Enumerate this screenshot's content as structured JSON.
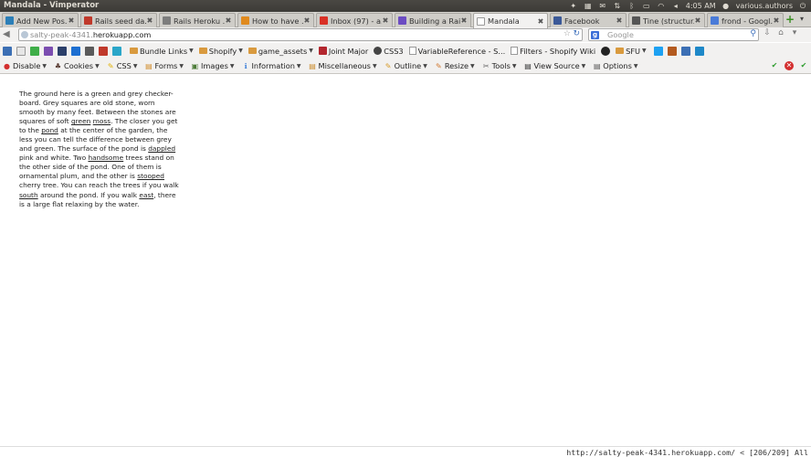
{
  "window": {
    "title": "Mandala - Vimperator"
  },
  "tray": {
    "time": "4:05 AM",
    "user": "various.authors"
  },
  "tabs": [
    {
      "label": "Add New Pos...",
      "color": "#2c7fb8"
    },
    {
      "label": "Rails seed da...",
      "color": "#c0392b"
    },
    {
      "label": "Rails Heroku ...",
      "color": "#7d7d7d"
    },
    {
      "label": "How to have ...",
      "color": "#e08a1e"
    },
    {
      "label": "Inbox (97) - a...",
      "color": "#d93025"
    },
    {
      "label": "Building a Rai...",
      "color": "#6c4cc2"
    },
    {
      "label": "Mandala",
      "color": "#ffffff"
    },
    {
      "label": "Facebook",
      "color": "#3b5998"
    },
    {
      "label": "Tine (structur...",
      "color": "#555555"
    },
    {
      "label": "frond - Googl...",
      "color": "#4a7bd8"
    }
  ],
  "nav": {
    "url_light": "salty-peak-4341.",
    "url_host": "herokuapp.com",
    "search_placeholder": "Google"
  },
  "bookmarks": {
    "items": [
      {
        "label": "Bundle Links",
        "has_menu": true
      },
      {
        "label": "Shopify",
        "has_menu": true
      },
      {
        "label": "game_assets",
        "has_menu": true
      },
      {
        "label": "Joint Major",
        "has_menu": false
      },
      {
        "label": "CSS3",
        "has_menu": false
      },
      {
        "label": "VariableReference - S...",
        "has_menu": false
      },
      {
        "label": "Filters - Shopify Wiki",
        "has_menu": false
      },
      {
        "label": "SFU",
        "has_menu": true
      }
    ]
  },
  "webdev": {
    "items": [
      {
        "label": "Disable"
      },
      {
        "label": "Cookies"
      },
      {
        "label": "CSS"
      },
      {
        "label": "Forms"
      },
      {
        "label": "Images"
      },
      {
        "label": "Information"
      },
      {
        "label": "Miscellaneous"
      },
      {
        "label": "Outline"
      },
      {
        "label": "Resize"
      },
      {
        "label": "Tools"
      },
      {
        "label": "View Source"
      },
      {
        "label": "Options"
      }
    ]
  },
  "content": {
    "segments": [
      {
        "t": "The ground here is a green and grey checker-board. Grey squares are old stone, worn smooth by many feet. Between the stones are squares of soft "
      },
      {
        "t": "green",
        "link": true
      },
      {
        "t": " "
      },
      {
        "t": "moss",
        "link": true
      },
      {
        "t": ". The closer you get to the "
      },
      {
        "t": "pond",
        "link": true
      },
      {
        "t": " at the center of the garden, the less you can tell the difference between grey and green. The surface of the pond is "
      },
      {
        "t": "dappled",
        "link": true
      },
      {
        "t": " pink and white. Two "
      },
      {
        "t": "handsome",
        "link": true
      },
      {
        "t": " trees stand on the other side of the pond. One of them is ornamental plum, and the other is "
      },
      {
        "t": "stooped",
        "link": true
      },
      {
        "t": " cherry tree. You can reach the trees if you walk "
      },
      {
        "t": "south",
        "link": true
      },
      {
        "t": " around the pond. If you walk "
      },
      {
        "t": "east",
        "link": true
      },
      {
        "t": ", there is a large flat relaxing by the water."
      }
    ]
  },
  "status": {
    "text": "http://salty-peak-4341.herokuapp.com/ < [206/209] All"
  }
}
